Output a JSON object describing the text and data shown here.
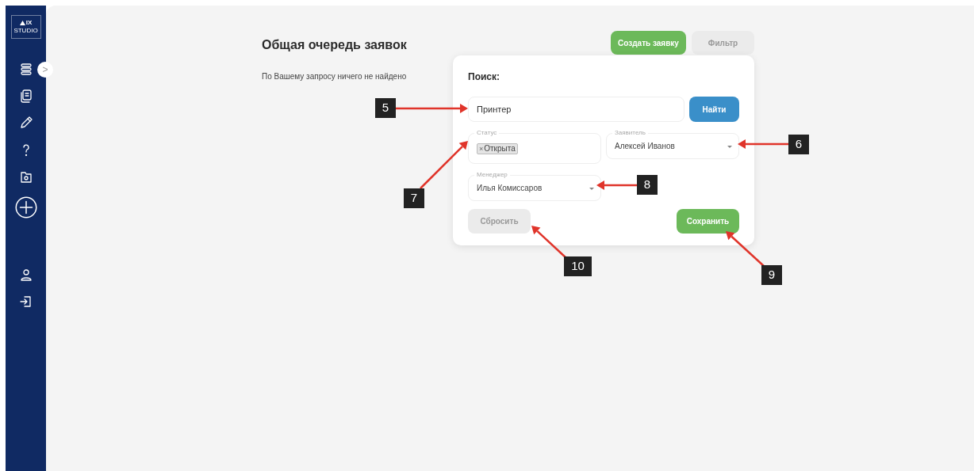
{
  "sidebar": {
    "logo": {
      "mark": "IX",
      "sub": "STUDIO"
    },
    "items": [
      {
        "kind": "list"
      },
      {
        "kind": "documents"
      },
      {
        "kind": "pencil"
      },
      {
        "kind": "help"
      },
      {
        "kind": "folder"
      },
      {
        "kind": "add"
      },
      {
        "kind": "user"
      },
      {
        "kind": "logout"
      }
    ],
    "collapse_toggle": ">"
  },
  "page": {
    "title": "Общая очередь заявок",
    "empty_message": "По Вашему запросу ничего не найдено",
    "create_button": "Создать заявку",
    "filter_button": "Фильтр"
  },
  "filter_panel": {
    "heading": "Поиск:",
    "search": {
      "value": "Принтер"
    },
    "find_button": "Найти",
    "status": {
      "label": "Статус",
      "tags": [
        {
          "remove": "×",
          "text": "Открыта"
        }
      ]
    },
    "applicant": {
      "label": "Заявитель",
      "value": "Алексей Иванов"
    },
    "manager": {
      "label": "Менеджер",
      "value": "Илья Комиссаров"
    },
    "reset_button": "Сбросить",
    "save_button": "Сохранить"
  },
  "annotations": [
    "5",
    "6",
    "7",
    "8",
    "9",
    "10"
  ]
}
